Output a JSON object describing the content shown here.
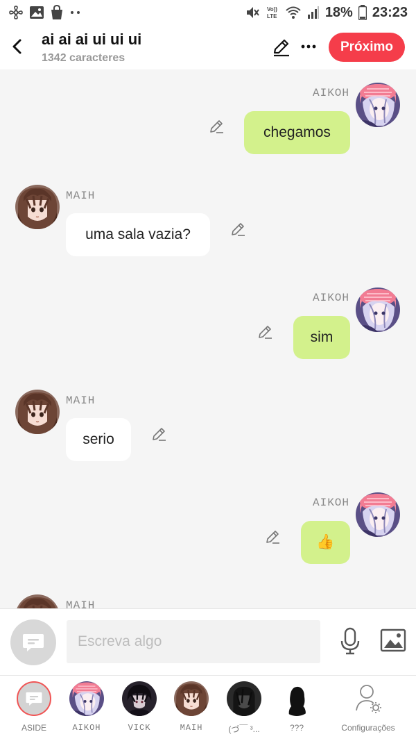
{
  "status_bar": {
    "battery": "18%",
    "time": "23:23",
    "network": "LTE"
  },
  "header": {
    "title": "ai ai ai ui ui ui",
    "subtitle": "1342 caracteres",
    "next_label": "Próximo"
  },
  "messages": [
    {
      "author": "AIKOH",
      "text": "chegamos",
      "side": "right"
    },
    {
      "author": "MAIH",
      "text": "uma sala vazia?",
      "side": "left"
    },
    {
      "author": "AIKOH",
      "text": "sim",
      "side": "right"
    },
    {
      "author": "MAIH",
      "text": "serio",
      "side": "left"
    },
    {
      "author": "AIKOH",
      "text": "👍",
      "side": "right"
    },
    {
      "author": "MAIH",
      "text": "",
      "side": "left"
    }
  ],
  "composer": {
    "placeholder": "Escreva algo"
  },
  "bottom_nav": [
    {
      "label": "ASIDE"
    },
    {
      "label": "AIKOH"
    },
    {
      "label": "VICK"
    },
    {
      "label": "MAIH"
    },
    {
      "label": "(づ￣ ³..."
    },
    {
      "label": "???"
    },
    {
      "label": "Configurações"
    }
  ],
  "colors": {
    "accent": "#f53d4a",
    "bubble_right": "#d3f18c",
    "bubble_left": "#ffffff",
    "background": "#f5f5f5"
  }
}
